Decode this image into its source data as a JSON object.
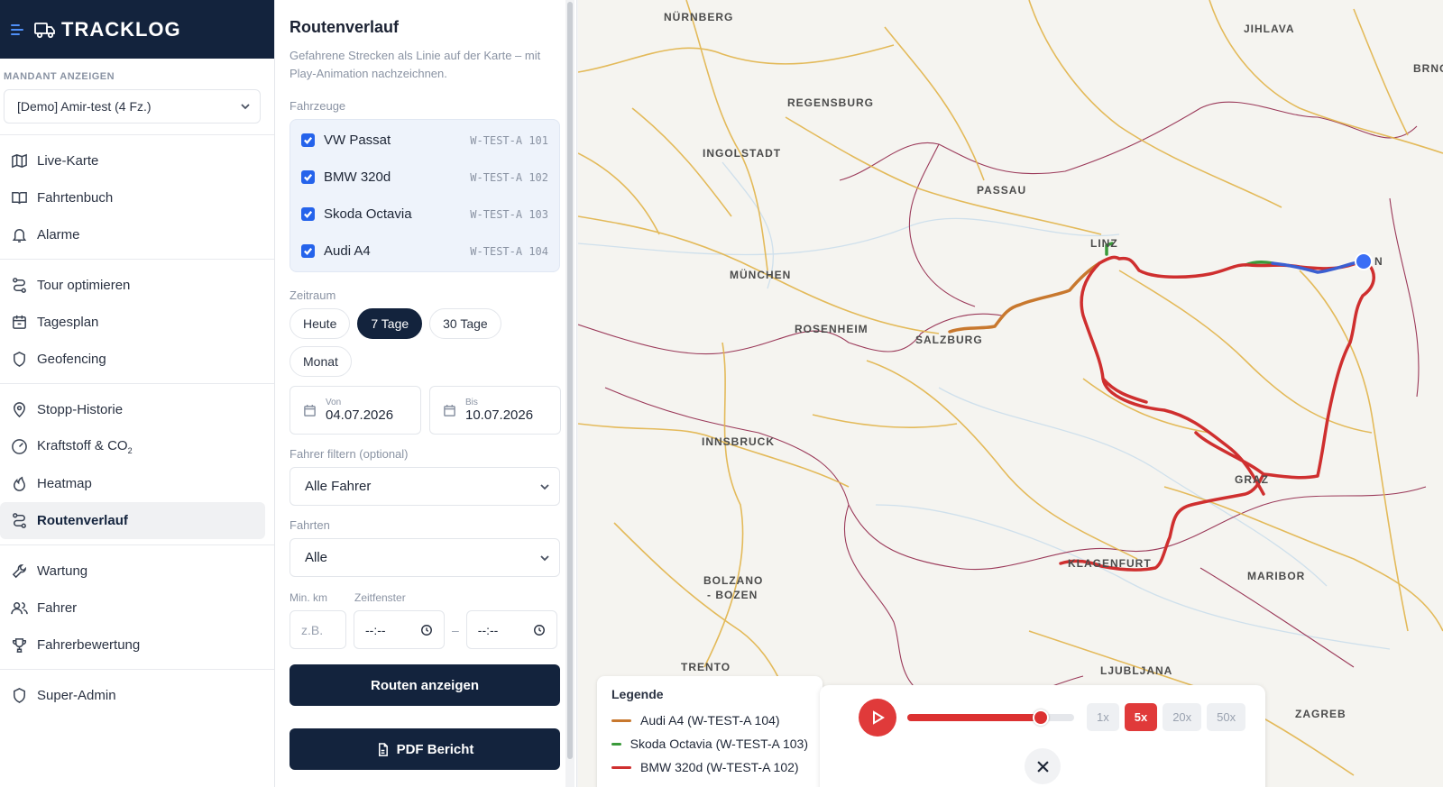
{
  "app": {
    "title": "TRACKLOG"
  },
  "mandant": {
    "label": "MANDANT ANZEIGEN",
    "value": "[Demo] Amir-test (4 Fz.)"
  },
  "nav": {
    "live_karte": "Live-Karte",
    "fahrtenbuch": "Fahrtenbuch",
    "alarme": "Alarme",
    "tour_optimieren": "Tour optimieren",
    "tagesplan": "Tagesplan",
    "geofencing": "Geofencing",
    "stopp_historie": "Stopp-Historie",
    "kraftstoff": "Kraftstoff & CO",
    "kraftstoff_sub": "2",
    "heatmap": "Heatmap",
    "routenverlauf": "Routenverlauf",
    "wartung": "Wartung",
    "fahrer": "Fahrer",
    "fahrerbewertung": "Fahrerbewertung",
    "super_admin": "Super-Admin"
  },
  "panel": {
    "title": "Routenverlauf",
    "description": "Gefahrene Strecken als Linie auf der Karte – mit Play-Animation nachzeichnen.",
    "vehicles_label": "Fahrzeuge",
    "vehicles": [
      {
        "name": "VW Passat",
        "plate": "W-TEST-A 101",
        "checked": true
      },
      {
        "name": "BMW 320d",
        "plate": "W-TEST-A 102",
        "checked": true
      },
      {
        "name": "Skoda Octavia",
        "plate": "W-TEST-A 103",
        "checked": true
      },
      {
        "name": "Audi A4",
        "plate": "W-TEST-A 104",
        "checked": true
      }
    ],
    "zeitraum_label": "Zeitraum",
    "periods": {
      "heute": "Heute",
      "sieben": "7 Tage",
      "dreissig": "30 Tage",
      "monat": "Monat"
    },
    "selected_period": "7 Tage",
    "von_label": "Von",
    "von_value": "04.07.2026",
    "bis_label": "Bis",
    "bis_value": "10.07.2026",
    "fahrer_label": "Fahrer filtern (optional)",
    "fahrer_value": "Alle Fahrer",
    "fahrten_label": "Fahrten",
    "fahrten_value": "Alle",
    "min_km_label": "Min. km",
    "min_km_placeholder": "z.B.",
    "zeitfenster_label": "Zeitfenster",
    "time_placeholder": "--:--",
    "time_sep": "–",
    "show_button": "Routen anzeigen",
    "pdf_button": "PDF Bericht"
  },
  "map": {
    "cities": {
      "nuernberg": "NÜRNBERG",
      "jihlava": "JIHLAVA",
      "brno": "BRNO",
      "regensburg": "REGENSBURG",
      "ingolstadt": "INGOLSTADT",
      "passau": "PASSAU",
      "linz": "LINZ",
      "wien": "N",
      "muenchen": "MÜNCHEN",
      "rosenheim": "ROSENHEIM",
      "salzburg": "SALZBURG",
      "innsbruck": "INNSBRUCK",
      "graz": "GRAZ",
      "klagenfurt": "KLAGENFURT",
      "maribor": "MARIBOR",
      "bolzano": "BOLZANO",
      "bozen": "- BOZEN",
      "trento": "TRENTO",
      "ljubljana": "LJUBLJANA",
      "zagreb": "ZAGREB"
    },
    "legend": {
      "title": "Legende",
      "items": [
        {
          "label": "Audi A4 (W-TEST-A 104)",
          "color": "#c8782e"
        },
        {
          "label": "Skoda Octavia (W-TEST-A 103)",
          "color": "#3a9a3a"
        },
        {
          "label": "BMW 320d (W-TEST-A 102)",
          "color": "#cf2f2f"
        }
      ]
    },
    "player": {
      "progress_percent": 80,
      "speeds": {
        "s1": "1x",
        "s5": "5x",
        "s20": "20x",
        "s50": "50x"
      },
      "selected_speed": "5x"
    }
  },
  "colors": {
    "brand_dark": "#13233d",
    "accent_blue": "#2563eb",
    "route_red": "#cf2f2f",
    "route_orange": "#c8782e",
    "route_green": "#3a9a3a",
    "route_blue": "#3b5fd1"
  }
}
